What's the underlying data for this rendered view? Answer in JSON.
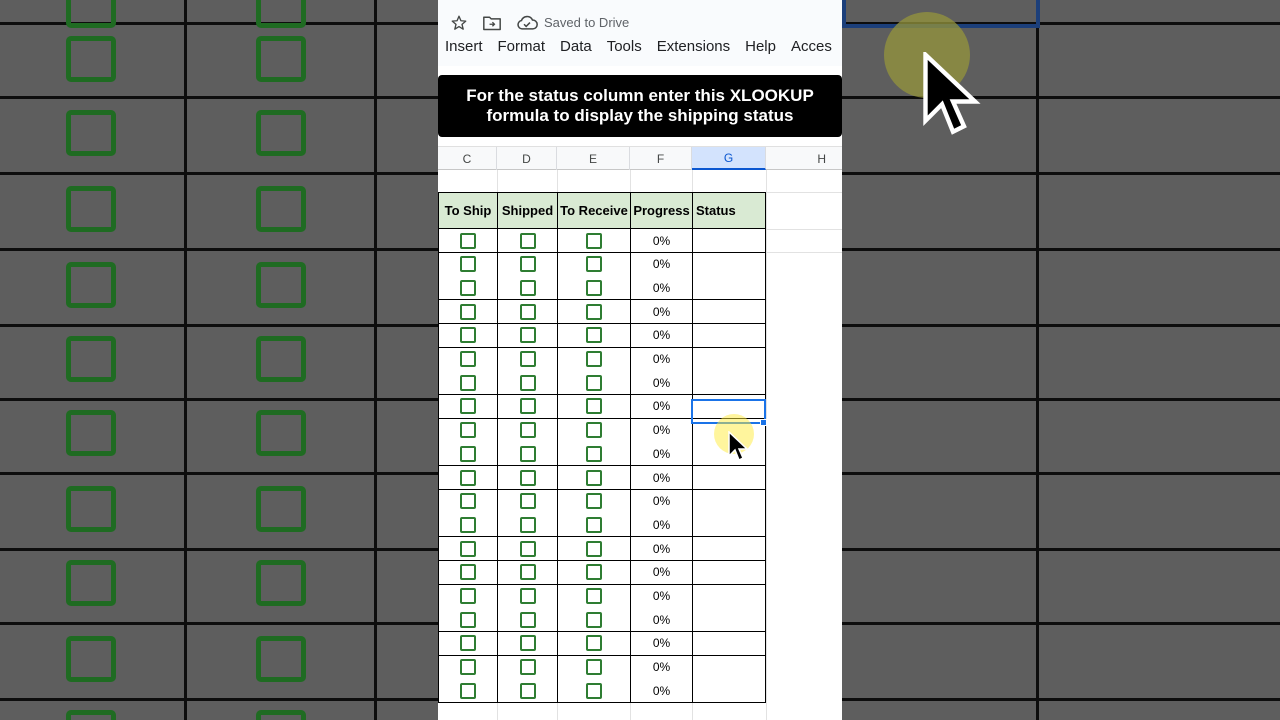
{
  "toolbar": {
    "saved_status": "Saved to Drive",
    "icons": [
      "star-icon",
      "move-to-folder-icon",
      "cloud-done-icon"
    ]
  },
  "menu": {
    "items": [
      "Insert",
      "Format",
      "Data",
      "Tools",
      "Extensions",
      "Help",
      "Acces"
    ]
  },
  "banner": {
    "line1": "For the status column enter this XLOOKUP",
    "line2": "formula to display the shipping status"
  },
  "sheet": {
    "columns": [
      "C",
      "D",
      "E",
      "F",
      "G",
      "H"
    ],
    "selected_column": "G",
    "headers": [
      "To Ship",
      "Shipped",
      "To Receive",
      "Progress",
      "Status"
    ],
    "progress_values": [
      "0%",
      "0%",
      "0%",
      "0%",
      "0%",
      "0%",
      "0%",
      "0%",
      "0%",
      "0%",
      "0%",
      "0%",
      "0%",
      "0%",
      "0%",
      "0%",
      "0%",
      "0%",
      "0%",
      "0%"
    ],
    "checkbox_state": "unchecked"
  },
  "colors": {
    "header_fill": "#d9ead3",
    "checkbox": "#2e7d32",
    "selection": "#1a73e8"
  }
}
